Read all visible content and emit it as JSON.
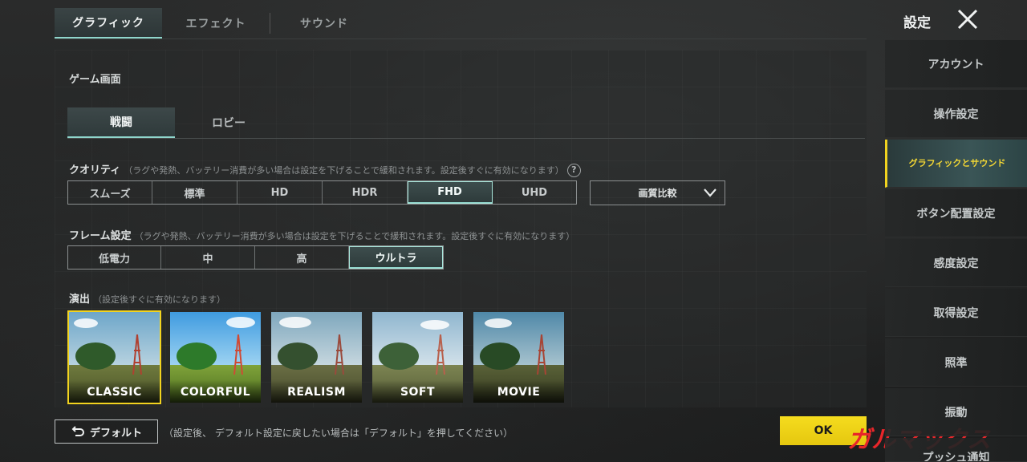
{
  "top_tabs": [
    {
      "label": "グラフィック",
      "active": true
    },
    {
      "label": "エフェクト",
      "active": false
    },
    {
      "label": "サウンド",
      "active": false
    }
  ],
  "header": {
    "title": "設定"
  },
  "section": {
    "title": "ゲーム画面"
  },
  "sub_tabs": [
    {
      "label": "戦闘",
      "active": true
    },
    {
      "label": "ロビー",
      "active": false
    }
  ],
  "quality": {
    "label": "クオリティ",
    "note": "（ラグや発熱、バッテリー消費が多い場合は設定を下げることで緩和されます。設定後すぐに有効になります）",
    "help": "?",
    "options": [
      "スムーズ",
      "標準",
      "HD",
      "HDR",
      "FHD",
      "UHD"
    ],
    "selected": "FHD",
    "compare_dropdown": "画質比較"
  },
  "frame": {
    "label": "フレーム設定",
    "note": "（ラグや発熱、バッテリー消費が多い場合は設定を下げることで緩和されます。設定後すぐに有効になります）",
    "options": [
      "低電力",
      "中",
      "高",
      "ウルトラ"
    ],
    "selected": "ウルトラ"
  },
  "style": {
    "label": "演出",
    "note": "（設定後すぐに有効になります）",
    "options": [
      "CLASSIC",
      "COLORFUL",
      "REALISM",
      "SOFT",
      "MOVIE"
    ],
    "selected": "CLASSIC"
  },
  "footer": {
    "default_label": "デフォルト",
    "default_note": "（設定後、 デフォルト設定に戻したい場合は「デフォルト」を押してください）",
    "ok_label": "OK"
  },
  "sidebar": {
    "items": [
      {
        "label": "アカウント"
      },
      {
        "label": "操作設定"
      },
      {
        "label": "グラフィックとサウンド",
        "active": true
      },
      {
        "label": "ボタン配置設定"
      },
      {
        "label": "感度設定"
      },
      {
        "label": "取得設定"
      },
      {
        "label": "照準"
      },
      {
        "label": "振動"
      },
      {
        "label": "プッシュ通知"
      }
    ]
  },
  "watermark": {
    "text": "ガルマックス"
  },
  "colors": {
    "accent": "#8fd6cc",
    "selected_yellow": "#f2d31f",
    "ok_button": "#f5dc1e",
    "watermark_red": "#e8262a"
  }
}
